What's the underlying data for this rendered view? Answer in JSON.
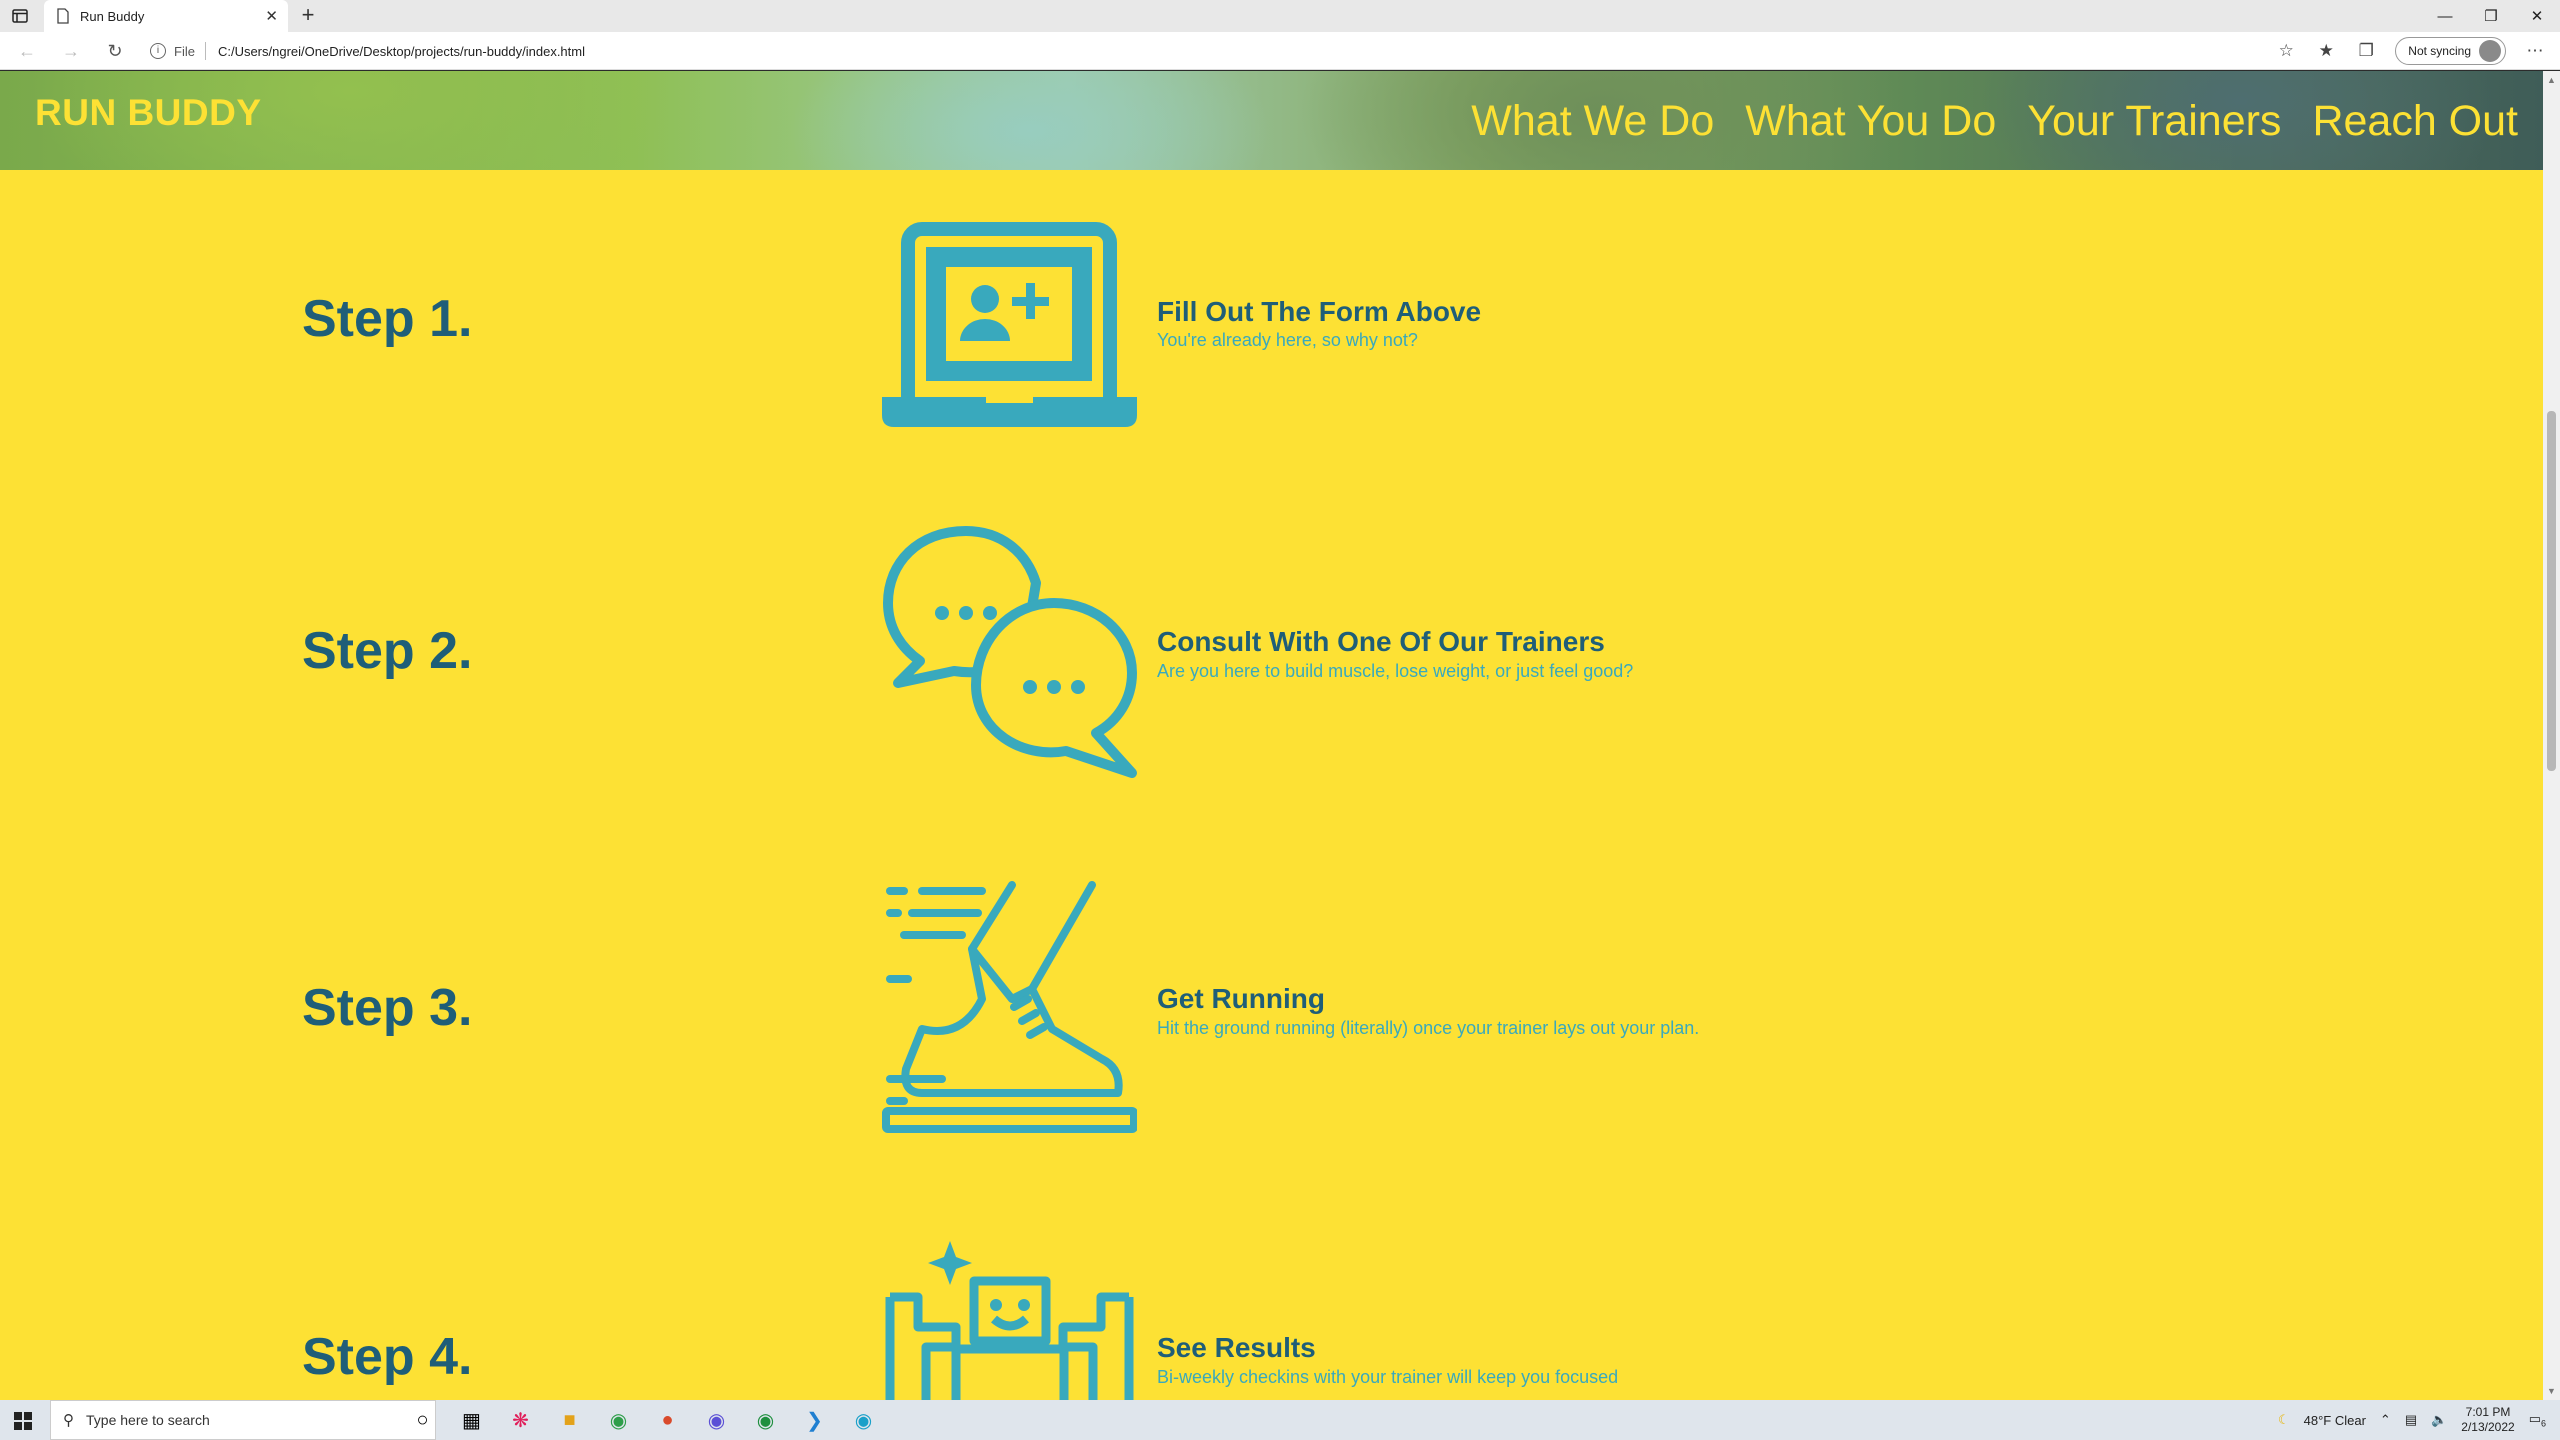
{
  "browser": {
    "tab_title": "Run Buddy",
    "tab_close": "✕",
    "new_tab": "+",
    "address_scheme": "File",
    "address_url": "C:/Users/ngrei/OneDrive/Desktop/projects/run-buddy/index.html",
    "sync_label": "Not syncing"
  },
  "page": {
    "brand": "RUN BUDDY",
    "nav": [
      "What We Do",
      "What You Do",
      "Your Trainers",
      "Reach Out"
    ],
    "steps": [
      {
        "title": "Step 1.",
        "icon": "laptop-add-user-icon",
        "heading": "Fill Out The Form Above",
        "desc": "You're already here, so why not?"
      },
      {
        "title": "Step 2.",
        "icon": "chat-bubbles-icon",
        "heading": "Consult With One Of Our Trainers",
        "desc": "Are you here to build muscle, lose weight, or just feel good?"
      },
      {
        "title": "Step 3.",
        "icon": "running-shoe-icon",
        "heading": "Get Running",
        "desc": "Hit the ground running (literally) once your trainer lays out your plan."
      },
      {
        "title": "Step 4.",
        "icon": "strong-robot-icon",
        "heading": "See Results",
        "desc": "Bi-weekly checkins with your trainer will keep you focused"
      }
    ]
  },
  "taskbar": {
    "search_placeholder": "Type here to search",
    "weather": "48°F  Clear",
    "time": "7:01 PM",
    "date": "2/13/2022",
    "notification_count": "6"
  },
  "colors": {
    "page_bg": "#fde134",
    "accent_dark": "#1f5e78",
    "accent_teal": "#39a9bd"
  }
}
